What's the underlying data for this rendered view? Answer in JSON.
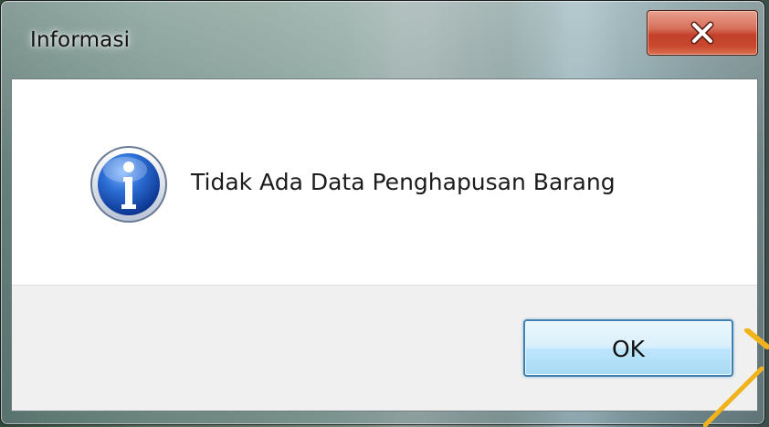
{
  "dialog": {
    "title": "Informasi",
    "message": "Tidak Ada Data Penghapusan Barang",
    "ok_label": "OK",
    "close_glyph": "X"
  },
  "icons": {
    "message_icon": "info-icon",
    "close_icon": "close-icon"
  },
  "colors": {
    "close_button": "#c8482e",
    "ok_border": "#3c7fb1",
    "info_icon_blue": "#1f5fbf",
    "watermark": "#f2b21b"
  }
}
